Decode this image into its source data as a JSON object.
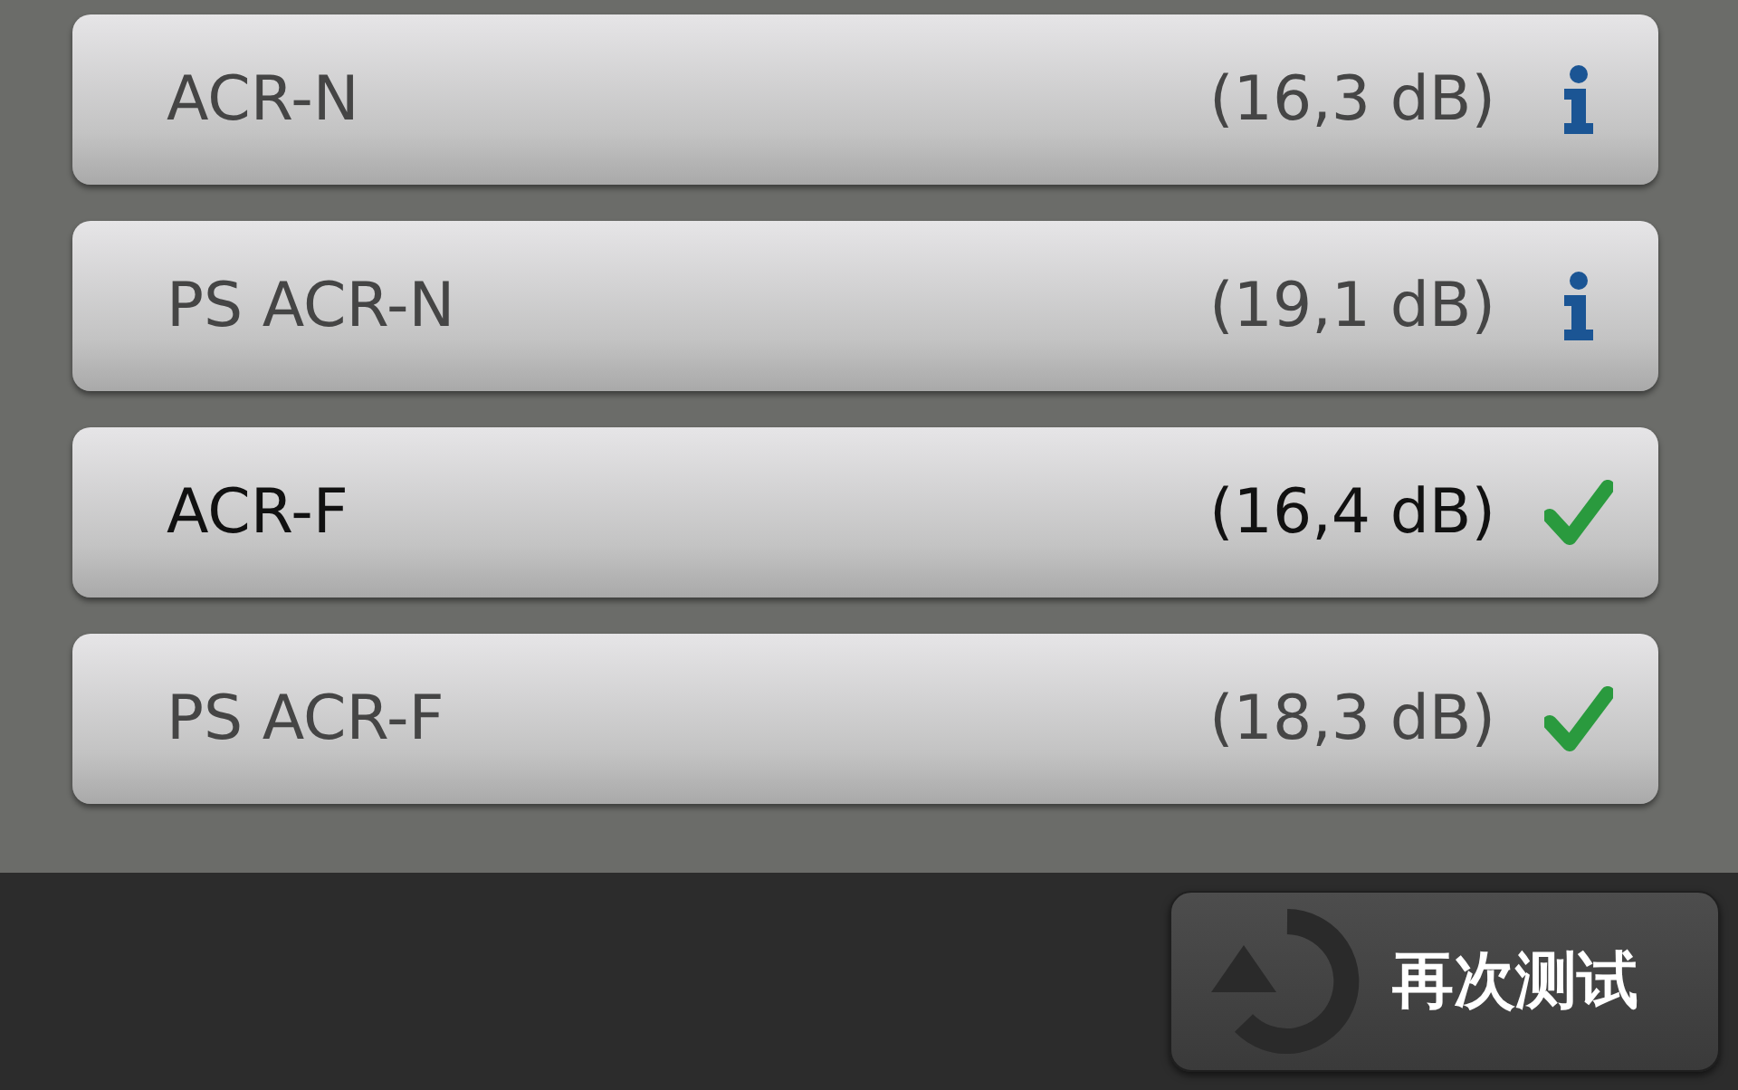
{
  "results": [
    {
      "name": "ACR-N",
      "value": "(16,3 dB)",
      "kind": "info",
      "highlighted": false
    },
    {
      "name": "PS ACR-N",
      "value": "(19,1 dB)",
      "kind": "info",
      "highlighted": false
    },
    {
      "name": "ACR-F",
      "value": "(16,4 dB)",
      "kind": "pass",
      "highlighted": true
    },
    {
      "name": "PS ACR-F",
      "value": "(18,3 dB)",
      "kind": "pass",
      "highlighted": false
    }
  ],
  "retest_button": {
    "label": "再次测试"
  }
}
